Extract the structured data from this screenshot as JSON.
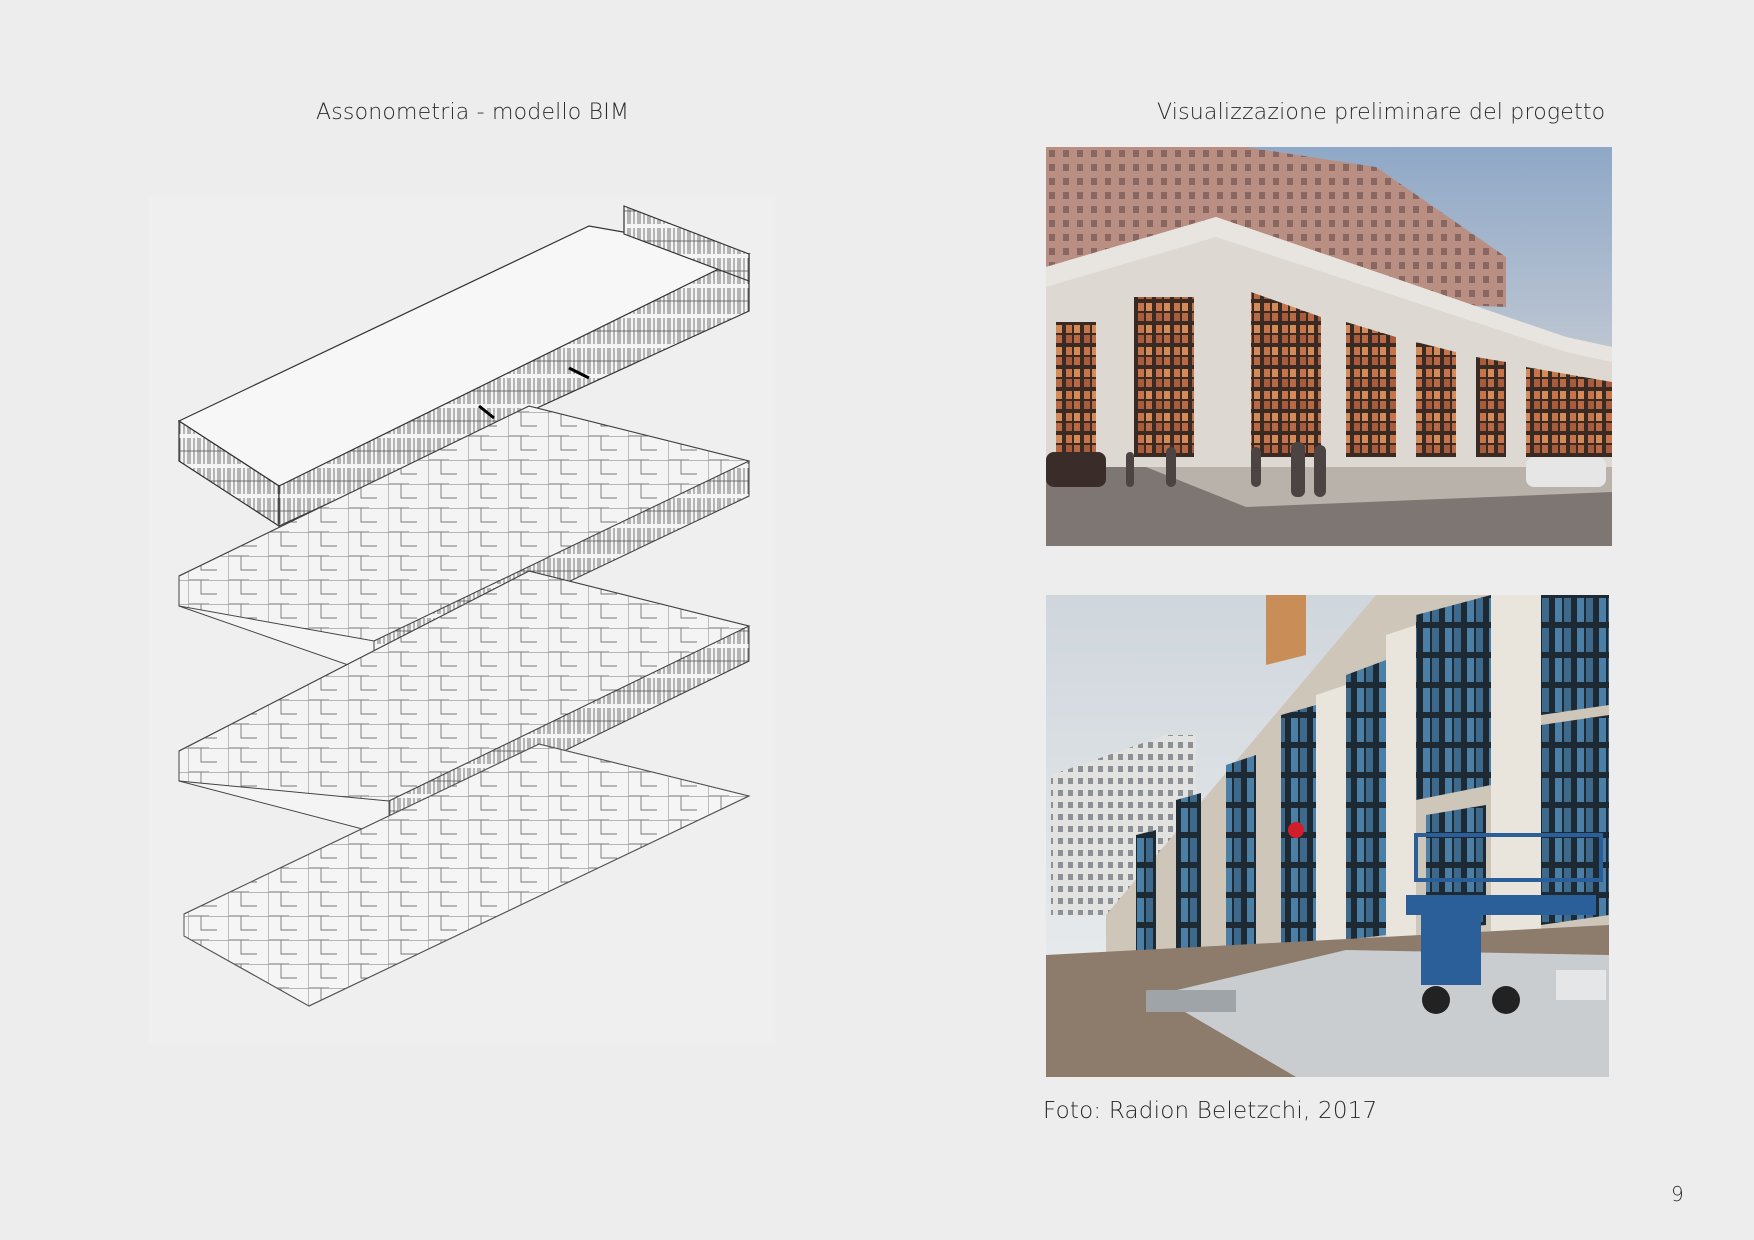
{
  "left_caption": "Assonometria - modello BIM",
  "right_caption": "Visualizzazione preliminare del progetto",
  "photo_credit": "Foto: Radion Beletzchi, 2017",
  "page_number": "9",
  "images": {
    "bim": "exploded-axonometric-bim-model",
    "render": "preliminary-facade-rendering",
    "photo": "construction-site-photo"
  }
}
